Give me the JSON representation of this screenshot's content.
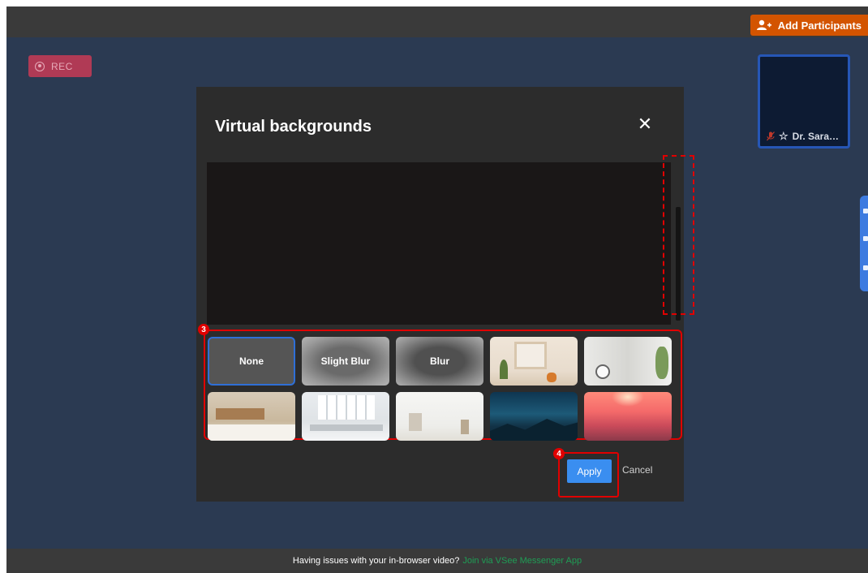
{
  "header": {
    "add_participants_label": "Add Participants"
  },
  "recording": {
    "label": "REC"
  },
  "participant": {
    "name": "Dr. Sara…"
  },
  "modal": {
    "title": "Virtual backgrounds",
    "close_label": "✕",
    "options": [
      {
        "label": "None",
        "selected": true
      },
      {
        "label": "Slight Blur"
      },
      {
        "label": "Blur"
      },
      {
        "label": ""
      },
      {
        "label": ""
      },
      {
        "label": ""
      },
      {
        "label": ""
      },
      {
        "label": ""
      },
      {
        "label": ""
      },
      {
        "label": ""
      }
    ],
    "apply_label": "Apply",
    "cancel_label": "Cancel"
  },
  "annotations": {
    "grid_step": "3",
    "apply_step": "4"
  },
  "footer": {
    "message": "Having issues with your in-browser video?",
    "link": "Join via VSee Messenger App"
  },
  "colors": {
    "accent_orange": "#d35400",
    "selection_blue": "#2656b6",
    "apply_blue": "#3a8ef0",
    "annotation_red": "#e10000",
    "link_green": "#1f9d55"
  }
}
